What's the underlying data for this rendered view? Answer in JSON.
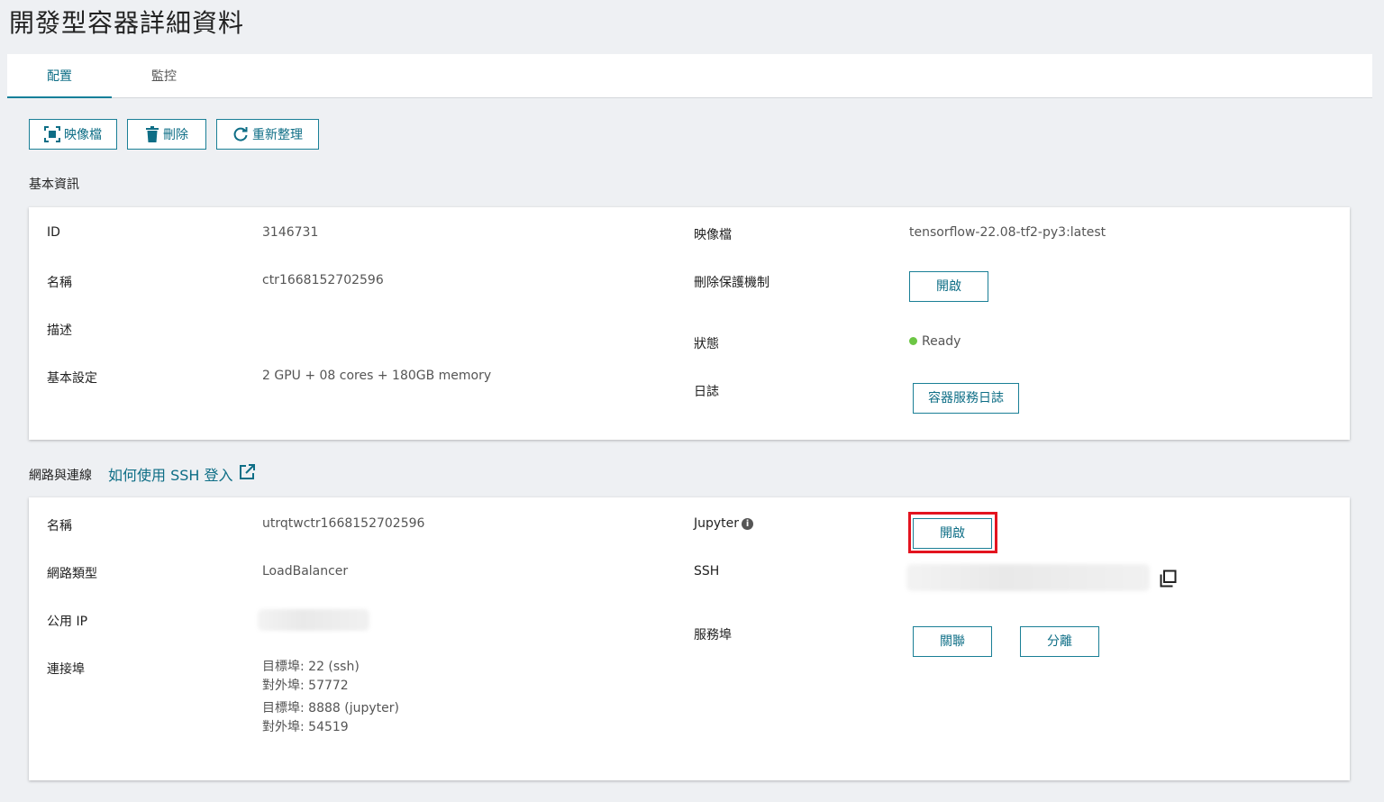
{
  "page": {
    "title": "開發型容器詳細資料"
  },
  "tabs": [
    {
      "label": "配置",
      "active": true
    },
    {
      "label": "監控",
      "active": false
    }
  ],
  "toolbar": {
    "image_label": "映像檔",
    "delete_label": "刪除",
    "refresh_label": "重新整理"
  },
  "basic": {
    "section_title": "基本資訊",
    "id_label": "ID",
    "id_value": "3146731",
    "name_label": "名稱",
    "name_value": "ctr1668152702596",
    "desc_label": "描述",
    "desc_value": "",
    "config_label": "基本設定",
    "config_value": "2 GPU + 08 cores + 180GB memory",
    "image_label": "映像檔",
    "image_value": "tensorflow-22.08-tf2-py3:latest",
    "protect_label": "刪除保護機制",
    "protect_button": "開啟",
    "status_label": "狀態",
    "status_value": "Ready",
    "log_label": "日誌",
    "log_button": "容器服務日誌"
  },
  "network": {
    "section_title": "網路與連線",
    "ssh_help_link": "如何使用 SSH 登入",
    "name_label": "名稱",
    "name_value": "utrqtwctr1668152702596",
    "type_label": "網路類型",
    "type_value": "LoadBalancer",
    "ip_label": "公用 IP",
    "ports_label": "連接埠",
    "ports": [
      {
        "target": "目標埠: 22 (ssh)",
        "external": "對外埠: 57772"
      },
      {
        "target": "目標埠: 8888 (jupyter)",
        "external": "對外埠: 54519"
      }
    ],
    "jupyter_label": "Jupyter",
    "jupyter_button": "開啟",
    "ssh_label": "SSH",
    "service_port_label": "服務埠",
    "associate_button": "關聯",
    "detach_button": "分離"
  },
  "colors": {
    "accent": "#0e6e86",
    "highlight": "#e3141f",
    "ready": "#6cc644"
  }
}
